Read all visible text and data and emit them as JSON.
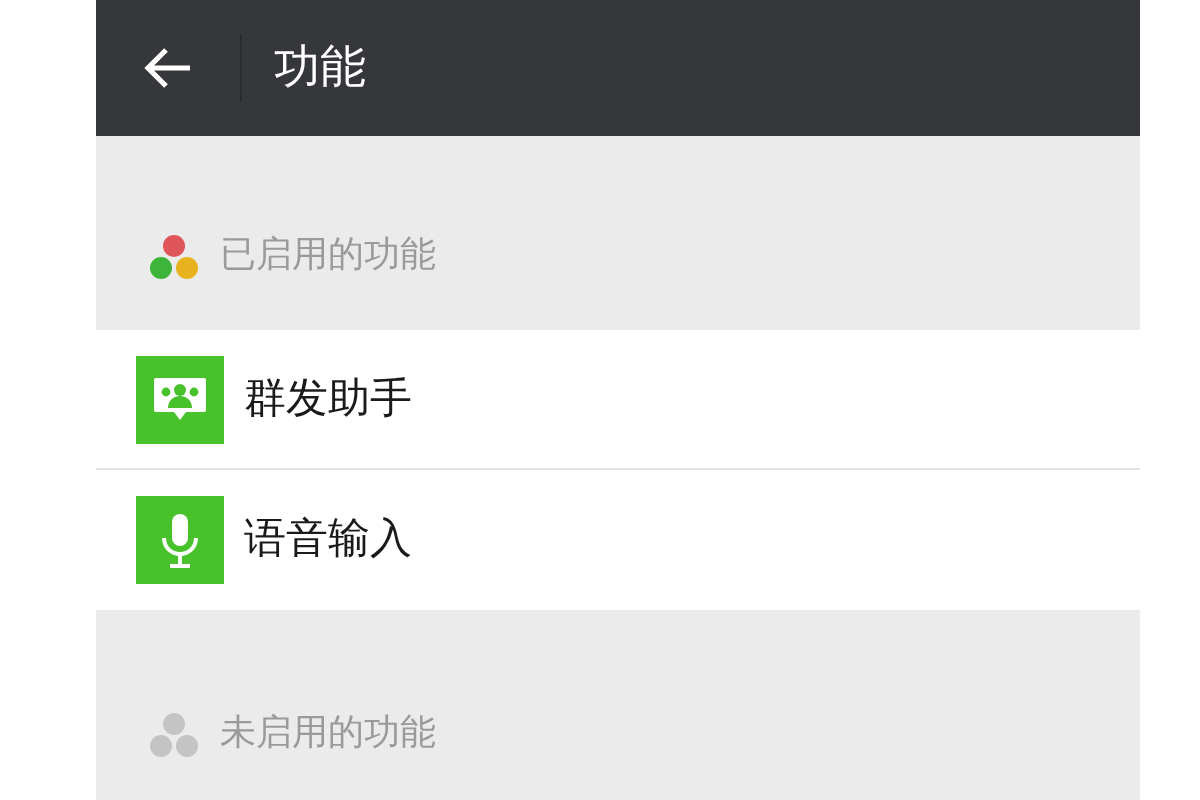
{
  "header": {
    "title": "功能"
  },
  "sections": [
    {
      "title": "已启用的功能",
      "kind": "enabled",
      "items": [
        {
          "label": "群发助手",
          "kind": "broadcast"
        },
        {
          "label": "语音输入",
          "kind": "voice"
        }
      ]
    },
    {
      "title": "未启用的功能",
      "kind": "disabled"
    }
  ]
}
